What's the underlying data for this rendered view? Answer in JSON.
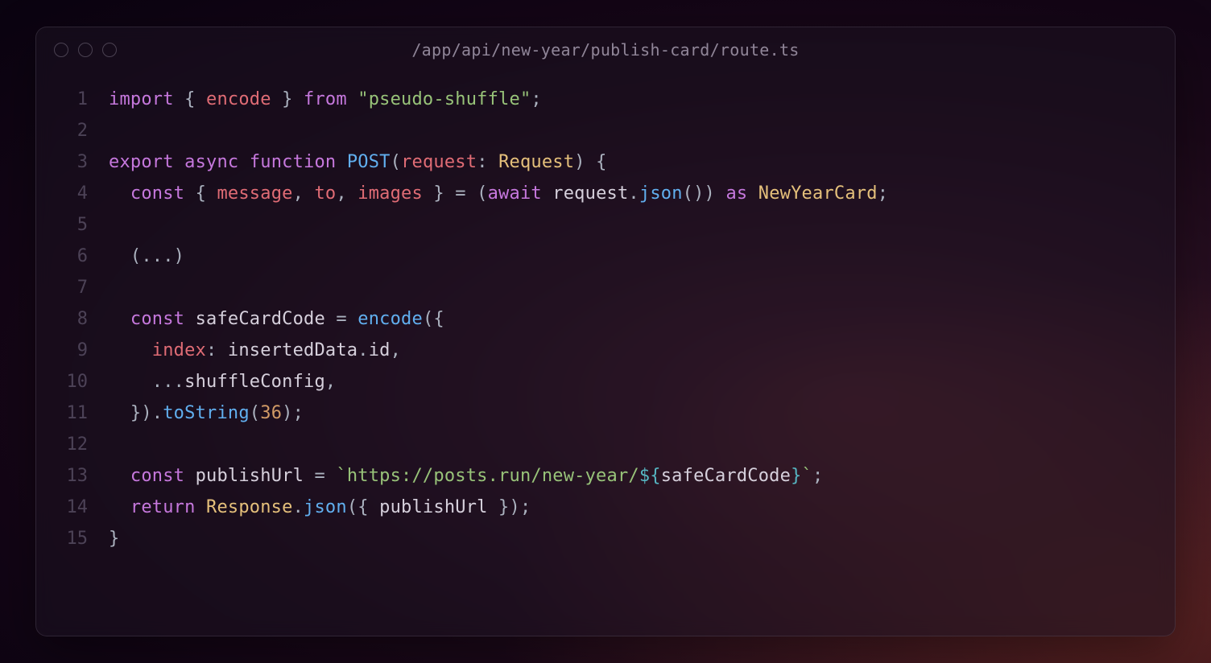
{
  "title": "/app/api/new-year/publish-card/route.ts",
  "line_numbers": {
    "l1": "1",
    "l2": "2",
    "l3": "3",
    "l4": "4",
    "l5": "5",
    "l6": "6",
    "l7": "7",
    "l8": "8",
    "l9": "9",
    "l10": "10",
    "l11": "11",
    "l12": "12",
    "l13": "13",
    "l14": "14",
    "l15": "15"
  },
  "code": {
    "l1": {
      "t1": "import",
      "t2": " { ",
      "t3": "encode",
      "t4": " } ",
      "t5": "from",
      "t6": " ",
      "t7": "\"pseudo-shuffle\"",
      "t8": ";"
    },
    "l2": {},
    "l3": {
      "t1": "export",
      "t2": " ",
      "t3": "async",
      "t4": " ",
      "t5": "function",
      "t6": " ",
      "t7": "POST",
      "t8": "(",
      "t9": "request",
      "t10": ": ",
      "t11": "Request",
      "t12": ") {"
    },
    "l4": {
      "t1": "  ",
      "t2": "const",
      "t3": " { ",
      "t4": "message",
      "t5": ", ",
      "t6": "to",
      "t7": ", ",
      "t8": "images",
      "t9": " } = (",
      "t10": "await",
      "t11": " ",
      "t12": "request",
      "t13": ".",
      "t14": "json",
      "t15": "()) ",
      "t16": "as",
      "t17": " ",
      "t18": "NewYearCard",
      "t19": ";"
    },
    "l5": {},
    "l6": {
      "t1": "  (...)"
    },
    "l7": {},
    "l8": {
      "t1": "  ",
      "t2": "const",
      "t3": " ",
      "t4": "safeCardCode",
      "t5": " = ",
      "t6": "encode",
      "t7": "({"
    },
    "l9": {
      "t1": "    ",
      "t2": "index",
      "t3": ": ",
      "t4": "insertedData",
      "t5": ".",
      "t6": "id",
      "t7": ","
    },
    "l10": {
      "t1": "    ...",
      "t2": "shuffleConfig",
      "t3": ","
    },
    "l11": {
      "t1": "  }).",
      "t2": "toString",
      "t3": "(",
      "t4": "36",
      "t5": ");"
    },
    "l12": {},
    "l13": {
      "t1": "  ",
      "t2": "const",
      "t3": " ",
      "t4": "publishUrl",
      "t5": " = ",
      "t6": "`https://posts.run/new-year/",
      "t7": "${",
      "t8": "safeCardCode",
      "t9": "}",
      "t10": "`",
      "t11": ";"
    },
    "l14": {
      "t1": "  ",
      "t2": "return",
      "t3": " ",
      "t4": "Response",
      "t5": ".",
      "t6": "json",
      "t7": "({ ",
      "t8": "publishUrl",
      "t9": " });"
    },
    "l15": {
      "t1": "}"
    }
  }
}
